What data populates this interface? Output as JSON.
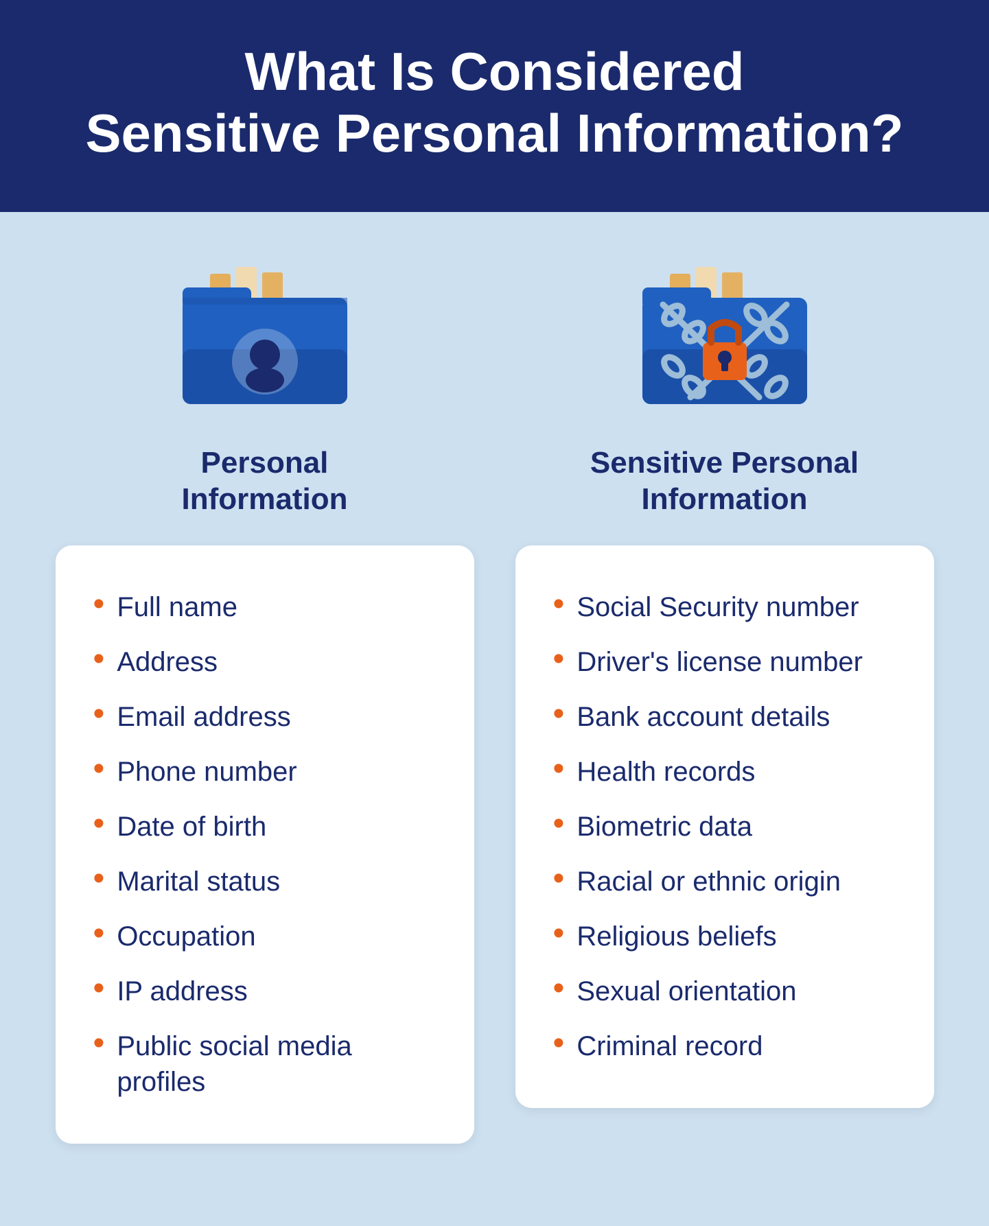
{
  "header": {
    "title_line1": "What Is Considered",
    "title_line2": "Sensitive Personal Information?"
  },
  "personal": {
    "column_title": "Personal\nInformation",
    "items": [
      "Full name",
      "Address",
      "Email address",
      "Phone number",
      "Date of birth",
      "Marital status",
      "Occupation",
      "IP address",
      "Public social media profiles"
    ]
  },
  "sensitive": {
    "column_title": "Sensitive Personal\nInformation",
    "items": [
      "Social Security number",
      "Driver's license number",
      "Bank account details",
      "Health records",
      "Biometric data",
      "Racial or ethnic origin",
      "Religious beliefs",
      "Sexual orientation",
      "Criminal record"
    ]
  },
  "colors": {
    "header_bg": "#1a2a6c",
    "main_bg": "#cde0f0",
    "title_color": "#1a2a6c",
    "bullet_color": "#e8611a",
    "card_bg": "#ffffff"
  }
}
